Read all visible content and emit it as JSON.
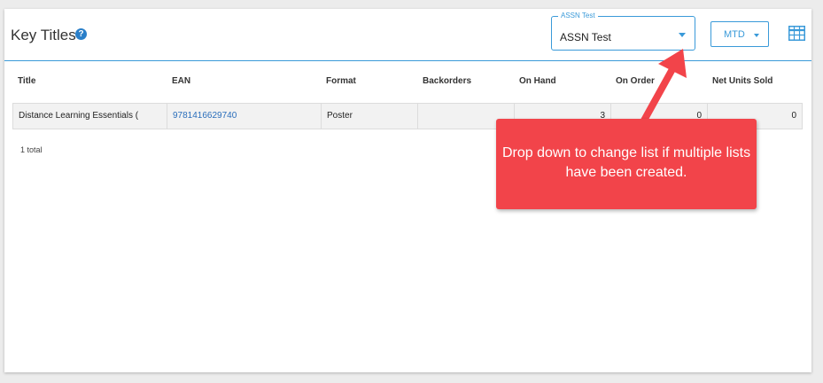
{
  "header": {
    "title": "Key Titles",
    "help_icon": "?",
    "list_select": {
      "legend": "ASSN Test",
      "value": "ASSN Test"
    },
    "period_button": "MTD",
    "grid_icon": "table-grid-icon"
  },
  "table": {
    "columns": [
      "Title",
      "EAN",
      "Format",
      "Backorders",
      "On Hand",
      "On Order",
      "Net Units Sold"
    ],
    "rows": [
      {
        "title": "Distance Learning Essentials (",
        "ean": "9781416629740",
        "format": "Poster",
        "backorders": "",
        "on_hand": "3",
        "on_order": "0",
        "net_units_sold": "0"
      }
    ],
    "total": "1 total"
  },
  "annotation": {
    "text": "Drop down to change list if multiple lists have been created.",
    "color": "#f2444a"
  },
  "colors": {
    "accent": "#3a9ad9",
    "link": "#2a6ebb"
  }
}
